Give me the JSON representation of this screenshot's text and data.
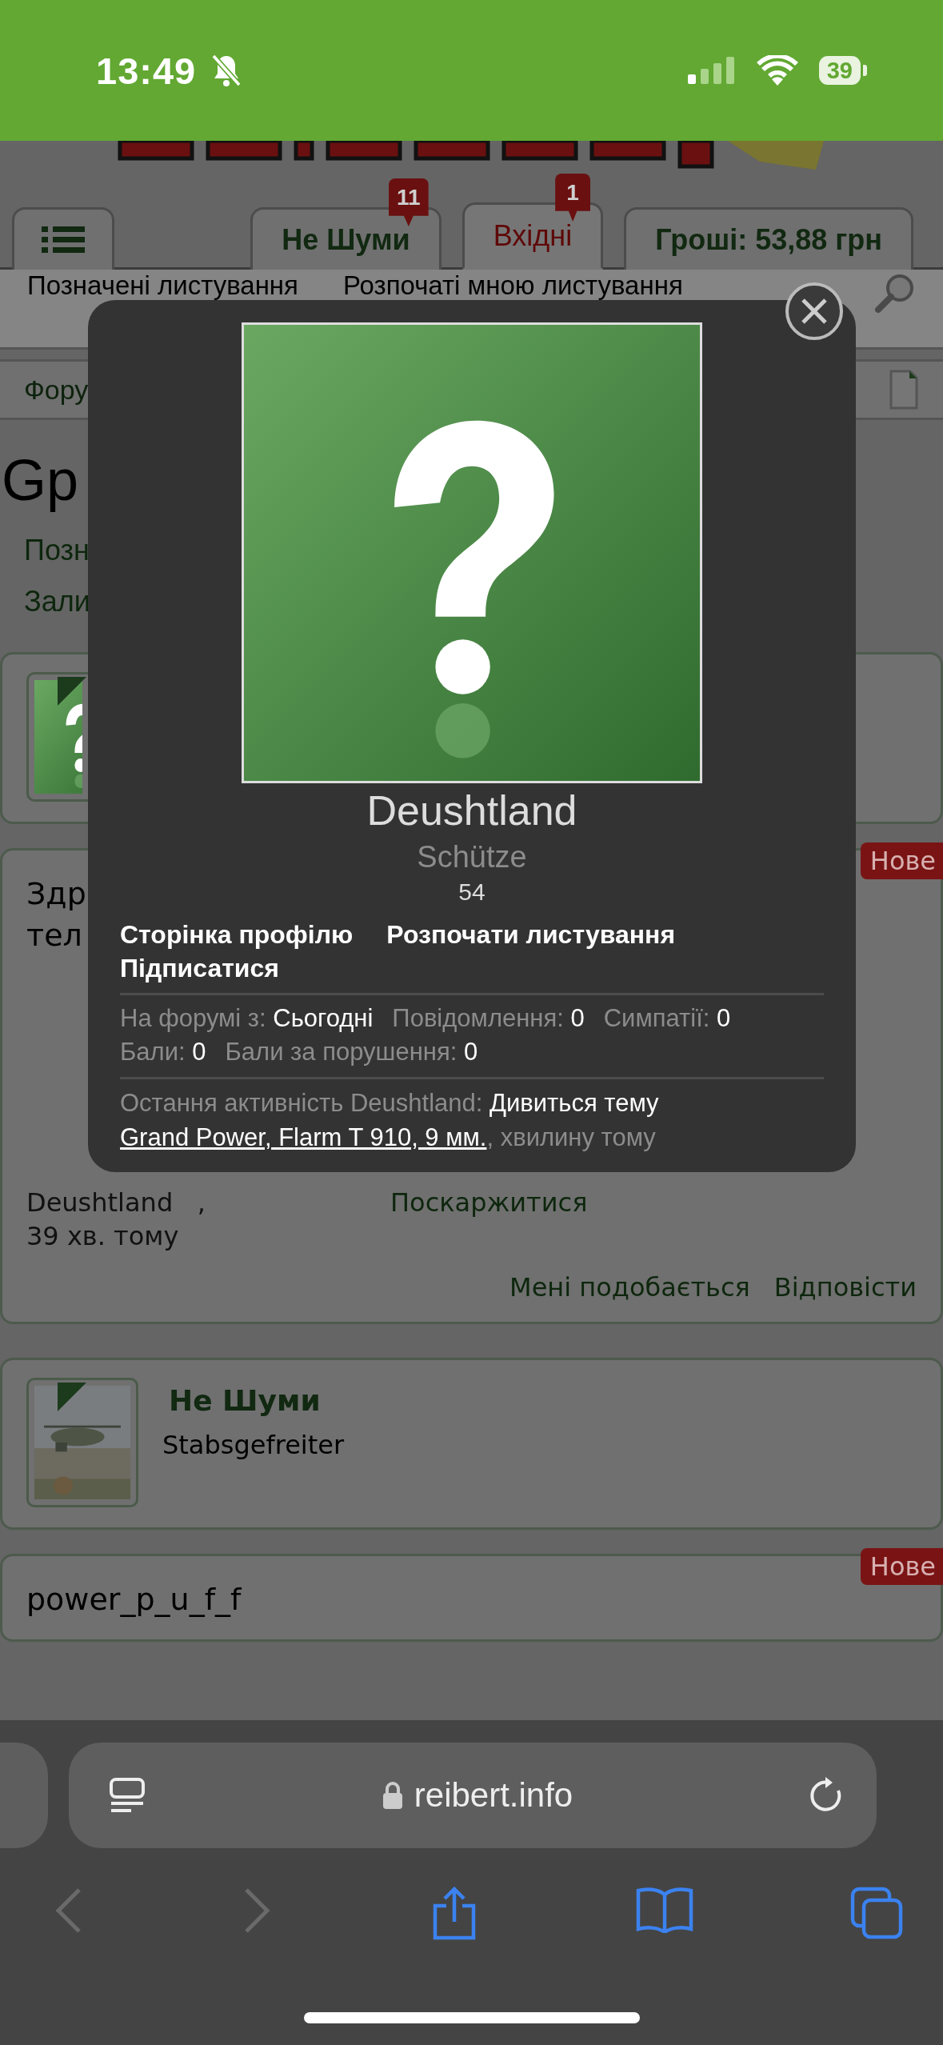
{
  "status_bar": {
    "time": "13:49",
    "silent": true,
    "battery": "39"
  },
  "page": {
    "tabs": [
      {
        "kind": "menu",
        "selected": false
      },
      {
        "kind": "text",
        "label": "Не Шуми",
        "badge": "11",
        "selected": false
      },
      {
        "kind": "text",
        "label": "Вхідні",
        "badge": "1",
        "selected": true
      },
      {
        "kind": "text",
        "label": "Гроші: 53,88 грн",
        "selected": false
      }
    ],
    "subnav": [
      "Позначені листування",
      "Розпочаті мною листування"
    ],
    "breadcrumb": "Фору",
    "title": "Gp",
    "meta_lines": [
      "Позн",
      "Зали"
    ],
    "posts": [
      {
        "user": {
          "kind": "default"
        },
        "message": {
          "lines": [
            "Здр",
            "тел"
          ],
          "badge": "Нове",
          "author": "Deushtland",
          "separator": ",",
          "time": "39 хв. тому",
          "report": "Поскаржитися",
          "actions": [
            "Мені подобається",
            "Відповісти"
          ]
        }
      },
      {
        "user": {
          "name": "Не Шуми",
          "rank": "Stabsgefreiter"
        },
        "message": {
          "lines": [
            "power_p_u_f_f"
          ],
          "badge": "Нове"
        }
      }
    ]
  },
  "popup": {
    "name": "Deushtland",
    "user_title": "Schütze",
    "number": "54",
    "links": [
      "Сторінка профілю",
      "Розпочати листування",
      "Підписатися"
    ],
    "stats": [
      [
        {
          "label": "На форумі з:",
          "value": "Сьогодні"
        },
        {
          "label": "Повідомлення:",
          "value": "0"
        },
        {
          "label": "Симпатії:",
          "value": "0"
        }
      ],
      [
        {
          "label": "Бали:",
          "value": "0"
        },
        {
          "label": "Бали за порушення:",
          "value": "0"
        }
      ]
    ],
    "activity": {
      "prefix": "Остання активність Deushtland:",
      "action": "Дивиться тему",
      "link": "Grand Power, Flarm T 910, 9 мм.",
      "suffix": ", хвилину тому"
    }
  },
  "browser": {
    "url": "reibert.info",
    "nav": [
      {
        "kind": "back",
        "disabled": true
      },
      {
        "kind": "forward",
        "disabled": true
      },
      {
        "kind": "share",
        "disabled": false
      },
      {
        "kind": "bookmarks",
        "disabled": false
      },
      {
        "kind": "tabs",
        "disabled": false
      }
    ]
  }
}
